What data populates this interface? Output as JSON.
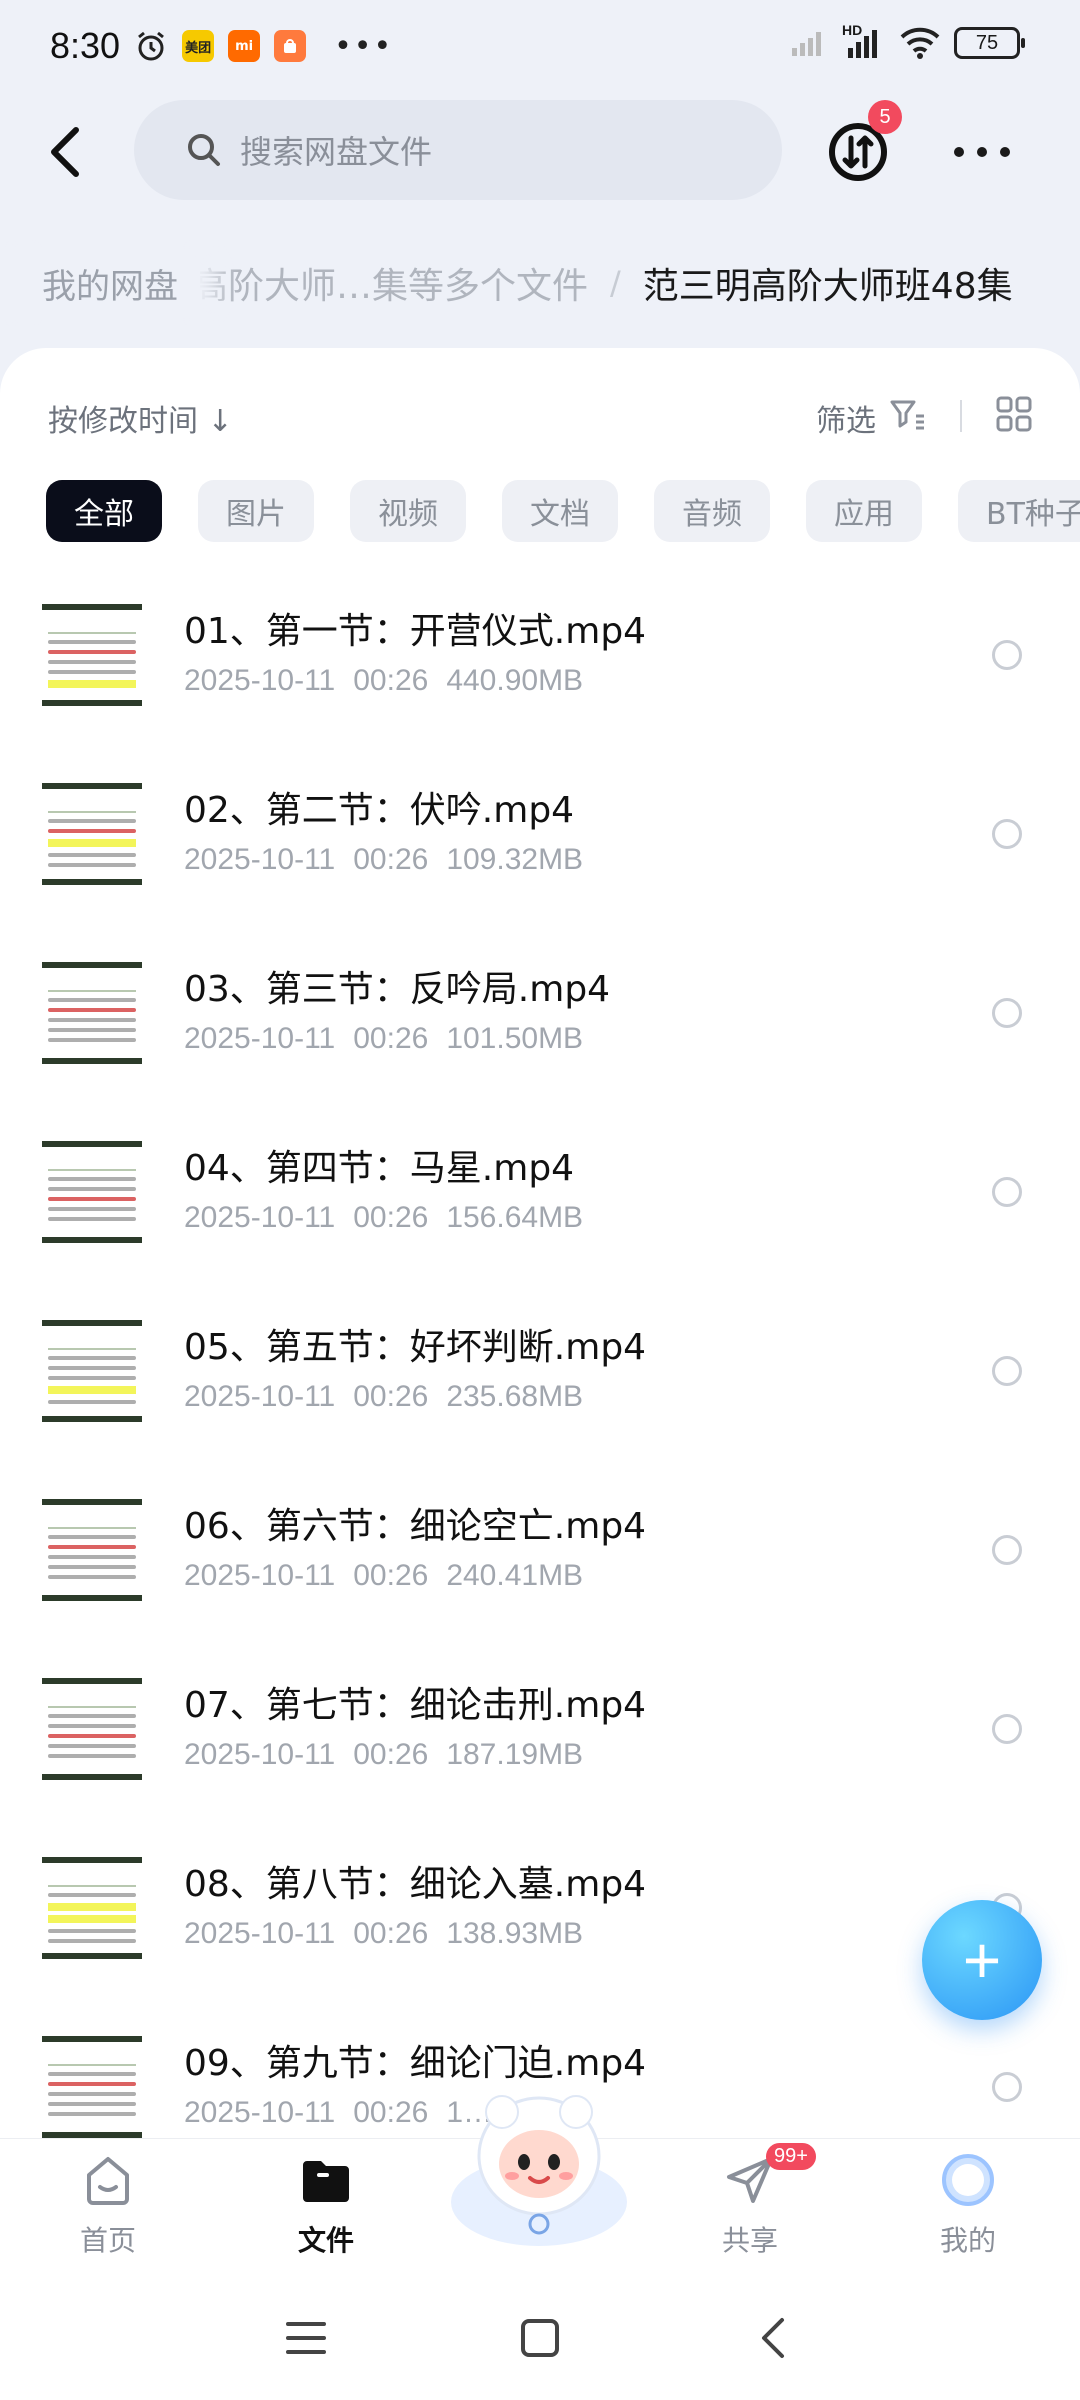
{
  "status": {
    "time": "8:30",
    "app_icons": [
      {
        "name": "meituan-app-icon",
        "label": "美团",
        "color": "#f6c900"
      },
      {
        "name": "xiaomi-app-icon",
        "label": "mi",
        "color": "#ff6a00"
      },
      {
        "name": "shop-app-icon",
        "label": "",
        "color": "#ff7a3d"
      }
    ],
    "network": "HD",
    "battery": "75"
  },
  "header": {
    "search_placeholder": "搜索网盘文件",
    "sync_badge": "5"
  },
  "breadcrumb": {
    "root": "我的网盘",
    "middle": "高阶大师…集等多个文件",
    "separator": "/",
    "current": "范三明高阶大师班48集"
  },
  "toolbar": {
    "sort_label": "按修改时间 ↓",
    "filter_label": "筛选"
  },
  "chips": [
    "全部",
    "图片",
    "视频",
    "文档",
    "音频",
    "应用",
    "BT种子"
  ],
  "active_chip": "全部",
  "files": [
    {
      "name": "01、第一节：开营仪式.mp4",
      "date": "2025-10-11",
      "time": "00:26",
      "size": "440.90MB"
    },
    {
      "name": "02、第二节：伏吟.mp4",
      "date": "2025-10-11",
      "time": "00:26",
      "size": "109.32MB"
    },
    {
      "name": "03、第三节：反吟局.mp4",
      "date": "2025-10-11",
      "time": "00:26",
      "size": "101.50MB"
    },
    {
      "name": "04、第四节：马星.mp4",
      "date": "2025-10-11",
      "time": "00:26",
      "size": "156.64MB"
    },
    {
      "name": "05、第五节：好坏判断.mp4",
      "date": "2025-10-11",
      "time": "00:26",
      "size": "235.68MB"
    },
    {
      "name": "06、第六节：细论空亡.mp4",
      "date": "2025-10-11",
      "time": "00:26",
      "size": "240.41MB"
    },
    {
      "name": "07、第七节：细论击刑.mp4",
      "date": "2025-10-11",
      "time": "00:26",
      "size": "187.19MB"
    },
    {
      "name": "08、第八节：细论入墓.mp4",
      "date": "2025-10-11",
      "time": "00:26",
      "size": "138.93MB"
    },
    {
      "name": "09、第九节：细论门迫.mp4",
      "date": "2025-10-11",
      "time": "00:26",
      "size": "1…MB"
    }
  ],
  "nav": {
    "home": "首页",
    "files": "文件",
    "share": "共享",
    "share_badge": "99+",
    "me": "我的"
  },
  "colors": {
    "accent": "#2a95f5",
    "badge": "#f24a5e",
    "chip_active": "#0a0d1a"
  }
}
